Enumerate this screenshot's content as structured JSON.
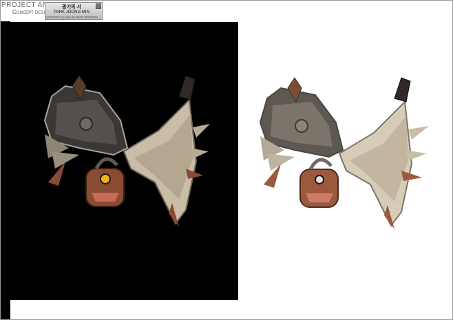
{
  "header": {
    "project_title": "PROJECT ANIMA",
    "subtitle": "Concept design",
    "plate_title_korean": "광기의 서",
    "artist_name": "PARK JOONG MIN",
    "copyright": "COPYRIGHT (C) CJ&C ALL RIGHT RESERVED"
  },
  "colors": {
    "background": "#ffffff",
    "panel": "#000000",
    "wing_light": "#c9bda8",
    "wing_dark": "#3b3734",
    "leather": "#8a4b33",
    "eye": "#f2b21b"
  }
}
